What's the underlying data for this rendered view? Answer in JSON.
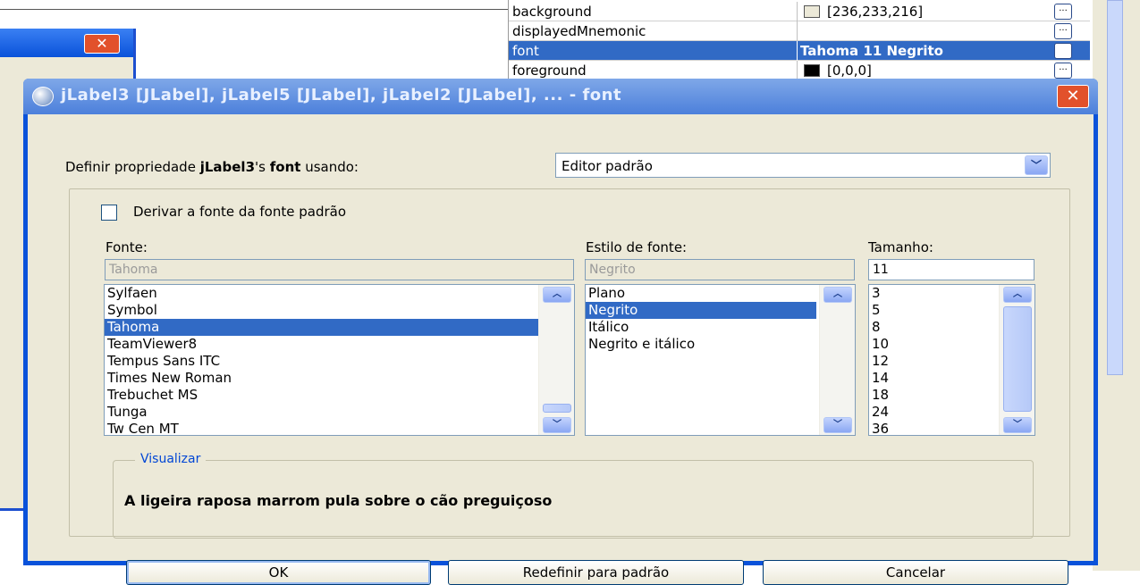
{
  "properties": {
    "rows": [
      {
        "name": "background",
        "value": "[236,233,216]",
        "swatch": "#ece9d8"
      },
      {
        "name": "displayedMnemonic",
        "value": ""
      },
      {
        "name": "font",
        "value": "Tahoma 11 Negrito"
      },
      {
        "name": "foreground",
        "value": "[0,0,0]",
        "swatch": "#000000"
      }
    ],
    "button_label": "..."
  },
  "background_window": {
    "close_glyph": "✕"
  },
  "dialog": {
    "title": "jLabel3 [JLabel], jLabel5 [JLabel], jLabel2 [JLabel], ... - font",
    "close_glyph": "✕",
    "define_prefix": "Definir propriedade ",
    "define_bold": "jLabel3",
    "define_mid": "'s ",
    "define_bold2": "font",
    "define_suffix": " usando:",
    "editor_combo": "Editor padrão",
    "derive_label": "Derivar a fonte da fonte padrão",
    "derive_checked": false,
    "font": {
      "label": "Fonte:",
      "field": "Tahoma",
      "items": [
        "Sylfaen",
        "Symbol",
        "Tahoma",
        "TeamViewer8",
        "Tempus Sans ITC",
        "Times New Roman",
        "Trebuchet MS",
        "Tunga",
        "Tw Cen MT"
      ],
      "selected": "Tahoma"
    },
    "style": {
      "label": "Estilo de fonte:",
      "field": "Negrito",
      "items": [
        "Plano",
        "Negrito",
        "Itálico",
        "Negrito e itálico"
      ],
      "selected": "Negrito"
    },
    "size": {
      "label": "Tamanho:",
      "field": "11",
      "items": [
        "3",
        "5",
        "8",
        "10",
        "12",
        "14",
        "18",
        "24",
        "36"
      ]
    },
    "preview": {
      "legend": "Visualizar",
      "text": "A ligeira raposa marrom pula sobre o cão preguiçoso"
    },
    "buttons": {
      "ok": "OK",
      "reset": "Redefinir para padrão",
      "cancel": "Cancelar"
    }
  },
  "colors": {
    "title_bar": "#4c80db",
    "selection": "#316ac5",
    "dialog_bg": "#ece9d8",
    "close_button": "#e2512b",
    "link_blue": "#0046d5"
  }
}
